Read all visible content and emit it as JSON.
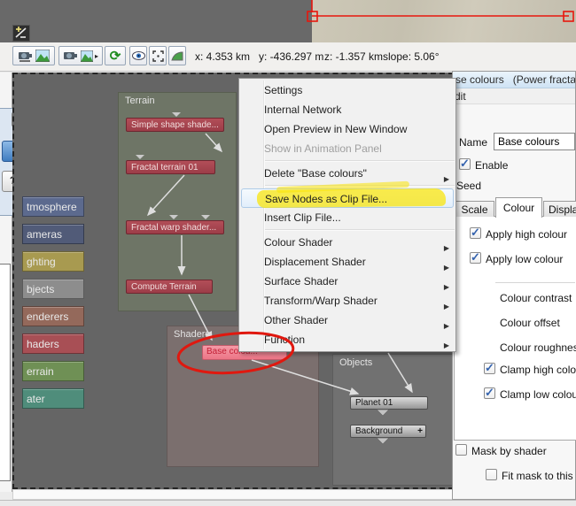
{
  "preview": {
    "coord_x": "x: 4.353 km",
    "coord_y": "y: -436.297 m",
    "coord_z": "z: -1.357 km",
    "coord_slope": "slope: 5.06°"
  },
  "icons": {
    "refresh": "⟳",
    "render_arrow": "▸",
    "submenu_arrow": "▶",
    "close": "✕",
    "help": "?",
    "plus": "+",
    "open_fragment": "n"
  },
  "sidebar": {
    "items": [
      {
        "label": "tmosphere",
        "color": "#5c6a8e"
      },
      {
        "label": "ameras",
        "color": "#515b78"
      },
      {
        "label": "ghting",
        "color": "#a89a50"
      },
      {
        "label": "bjects",
        "color": "#8d8d8d"
      },
      {
        "label": "enderers",
        "color": "#94695b"
      },
      {
        "label": "haders",
        "color": "#a84f55"
      },
      {
        "label": "errain",
        "color": "#6f9055"
      },
      {
        "label": "ater",
        "color": "#4f8d7b"
      }
    ]
  },
  "node_view": {
    "terrain_group": {
      "title": "Terrain",
      "node1": "Simple shape shade...",
      "node2": "Fractal terrain 01",
      "node3": "Fractal warp shader...",
      "node4": "Compute Terrain"
    },
    "shaders_group": {
      "title": "Shaders",
      "selected_node": "Base colou..."
    },
    "objects_group": {
      "title": "Objects",
      "planet": "Planet 01",
      "background": "Background"
    }
  },
  "context_menu": {
    "settings": "Settings",
    "internal_network": "Internal Network",
    "open_preview": "Open Preview in New Window",
    "show_in_animation_panel": "Show in Animation Panel",
    "delete_node": "Delete \"Base colours\"",
    "save_nodes": "Save Nodes as Clip File...",
    "insert_clip": "Insert Clip File...",
    "colour_shader": "Colour Shader",
    "displacement_shader": "Displacement Shader",
    "surface_shader": "Surface Shader",
    "transform_warp_shader": "Transform/Warp Shader",
    "other_shader": "Other Shader",
    "function": "Function"
  },
  "panel": {
    "title": "se colours   (Power fracta",
    "menu_fragment": "dit",
    "name_label": "Name",
    "name_value": "Base colours",
    "enable_label": "Enable",
    "seed_label": "Seed",
    "tabs": {
      "scale": "Scale",
      "colour": "Colour",
      "display": "Displacement"
    },
    "apply_high": "Apply high colour",
    "apply_low": "Apply low colour",
    "colour_contrast": "Colour contrast",
    "colour_offset": "Colour offset",
    "colour_roughness": "Colour roughness",
    "clamp_high": "Clamp high colour",
    "clamp_low": "Clamp low colour",
    "mask_by_shader": "Mask by shader",
    "fit_mask": "Fit mask to this"
  },
  "colors": {
    "node_red": "#a6444e",
    "node_selected_pink": "#ef8292",
    "annotation_red": "#e0180f",
    "highlight_yellow": "#f9e405",
    "terrain_group_bg": "#6e7566",
    "shaders_group_bg": "#7b6f6e",
    "objects_group_bg": "#717171",
    "panel_header_blue": "#d9eaf8"
  }
}
